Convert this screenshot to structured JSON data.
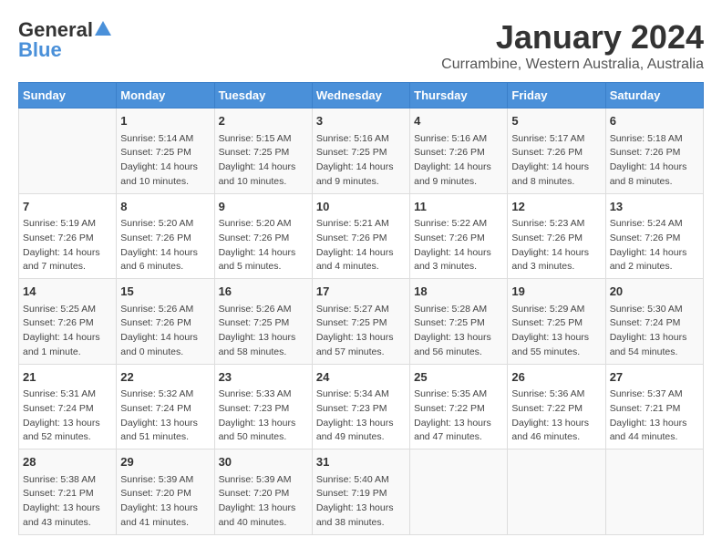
{
  "header": {
    "logo_general": "General",
    "logo_blue": "Blue",
    "month_title": "January 2024",
    "location": "Currambine, Western Australia, Australia"
  },
  "days_of_week": [
    "Sunday",
    "Monday",
    "Tuesday",
    "Wednesday",
    "Thursday",
    "Friday",
    "Saturday"
  ],
  "weeks": [
    [
      {
        "day": "",
        "content": ""
      },
      {
        "day": "1",
        "content": "Sunrise: 5:14 AM\nSunset: 7:25 PM\nDaylight: 14 hours\nand 10 minutes."
      },
      {
        "day": "2",
        "content": "Sunrise: 5:15 AM\nSunset: 7:25 PM\nDaylight: 14 hours\nand 10 minutes."
      },
      {
        "day": "3",
        "content": "Sunrise: 5:16 AM\nSunset: 7:25 PM\nDaylight: 14 hours\nand 9 minutes."
      },
      {
        "day": "4",
        "content": "Sunrise: 5:16 AM\nSunset: 7:26 PM\nDaylight: 14 hours\nand 9 minutes."
      },
      {
        "day": "5",
        "content": "Sunrise: 5:17 AM\nSunset: 7:26 PM\nDaylight: 14 hours\nand 8 minutes."
      },
      {
        "day": "6",
        "content": "Sunrise: 5:18 AM\nSunset: 7:26 PM\nDaylight: 14 hours\nand 8 minutes."
      }
    ],
    [
      {
        "day": "7",
        "content": "Sunrise: 5:19 AM\nSunset: 7:26 PM\nDaylight: 14 hours\nand 7 minutes."
      },
      {
        "day": "8",
        "content": "Sunrise: 5:20 AM\nSunset: 7:26 PM\nDaylight: 14 hours\nand 6 minutes."
      },
      {
        "day": "9",
        "content": "Sunrise: 5:20 AM\nSunset: 7:26 PM\nDaylight: 14 hours\nand 5 minutes."
      },
      {
        "day": "10",
        "content": "Sunrise: 5:21 AM\nSunset: 7:26 PM\nDaylight: 14 hours\nand 4 minutes."
      },
      {
        "day": "11",
        "content": "Sunrise: 5:22 AM\nSunset: 7:26 PM\nDaylight: 14 hours\nand 3 minutes."
      },
      {
        "day": "12",
        "content": "Sunrise: 5:23 AM\nSunset: 7:26 PM\nDaylight: 14 hours\nand 3 minutes."
      },
      {
        "day": "13",
        "content": "Sunrise: 5:24 AM\nSunset: 7:26 PM\nDaylight: 14 hours\nand 2 minutes."
      }
    ],
    [
      {
        "day": "14",
        "content": "Sunrise: 5:25 AM\nSunset: 7:26 PM\nDaylight: 14 hours\nand 1 minute."
      },
      {
        "day": "15",
        "content": "Sunrise: 5:26 AM\nSunset: 7:26 PM\nDaylight: 14 hours\nand 0 minutes."
      },
      {
        "day": "16",
        "content": "Sunrise: 5:26 AM\nSunset: 7:25 PM\nDaylight: 13 hours\nand 58 minutes."
      },
      {
        "day": "17",
        "content": "Sunrise: 5:27 AM\nSunset: 7:25 PM\nDaylight: 13 hours\nand 57 minutes."
      },
      {
        "day": "18",
        "content": "Sunrise: 5:28 AM\nSunset: 7:25 PM\nDaylight: 13 hours\nand 56 minutes."
      },
      {
        "day": "19",
        "content": "Sunrise: 5:29 AM\nSunset: 7:25 PM\nDaylight: 13 hours\nand 55 minutes."
      },
      {
        "day": "20",
        "content": "Sunrise: 5:30 AM\nSunset: 7:24 PM\nDaylight: 13 hours\nand 54 minutes."
      }
    ],
    [
      {
        "day": "21",
        "content": "Sunrise: 5:31 AM\nSunset: 7:24 PM\nDaylight: 13 hours\nand 52 minutes."
      },
      {
        "day": "22",
        "content": "Sunrise: 5:32 AM\nSunset: 7:24 PM\nDaylight: 13 hours\nand 51 minutes."
      },
      {
        "day": "23",
        "content": "Sunrise: 5:33 AM\nSunset: 7:23 PM\nDaylight: 13 hours\nand 50 minutes."
      },
      {
        "day": "24",
        "content": "Sunrise: 5:34 AM\nSunset: 7:23 PM\nDaylight: 13 hours\nand 49 minutes."
      },
      {
        "day": "25",
        "content": "Sunrise: 5:35 AM\nSunset: 7:22 PM\nDaylight: 13 hours\nand 47 minutes."
      },
      {
        "day": "26",
        "content": "Sunrise: 5:36 AM\nSunset: 7:22 PM\nDaylight: 13 hours\nand 46 minutes."
      },
      {
        "day": "27",
        "content": "Sunrise: 5:37 AM\nSunset: 7:21 PM\nDaylight: 13 hours\nand 44 minutes."
      }
    ],
    [
      {
        "day": "28",
        "content": "Sunrise: 5:38 AM\nSunset: 7:21 PM\nDaylight: 13 hours\nand 43 minutes."
      },
      {
        "day": "29",
        "content": "Sunrise: 5:39 AM\nSunset: 7:20 PM\nDaylight: 13 hours\nand 41 minutes."
      },
      {
        "day": "30",
        "content": "Sunrise: 5:39 AM\nSunset: 7:20 PM\nDaylight: 13 hours\nand 40 minutes."
      },
      {
        "day": "31",
        "content": "Sunrise: 5:40 AM\nSunset: 7:19 PM\nDaylight: 13 hours\nand 38 minutes."
      },
      {
        "day": "",
        "content": ""
      },
      {
        "day": "",
        "content": ""
      },
      {
        "day": "",
        "content": ""
      }
    ]
  ]
}
